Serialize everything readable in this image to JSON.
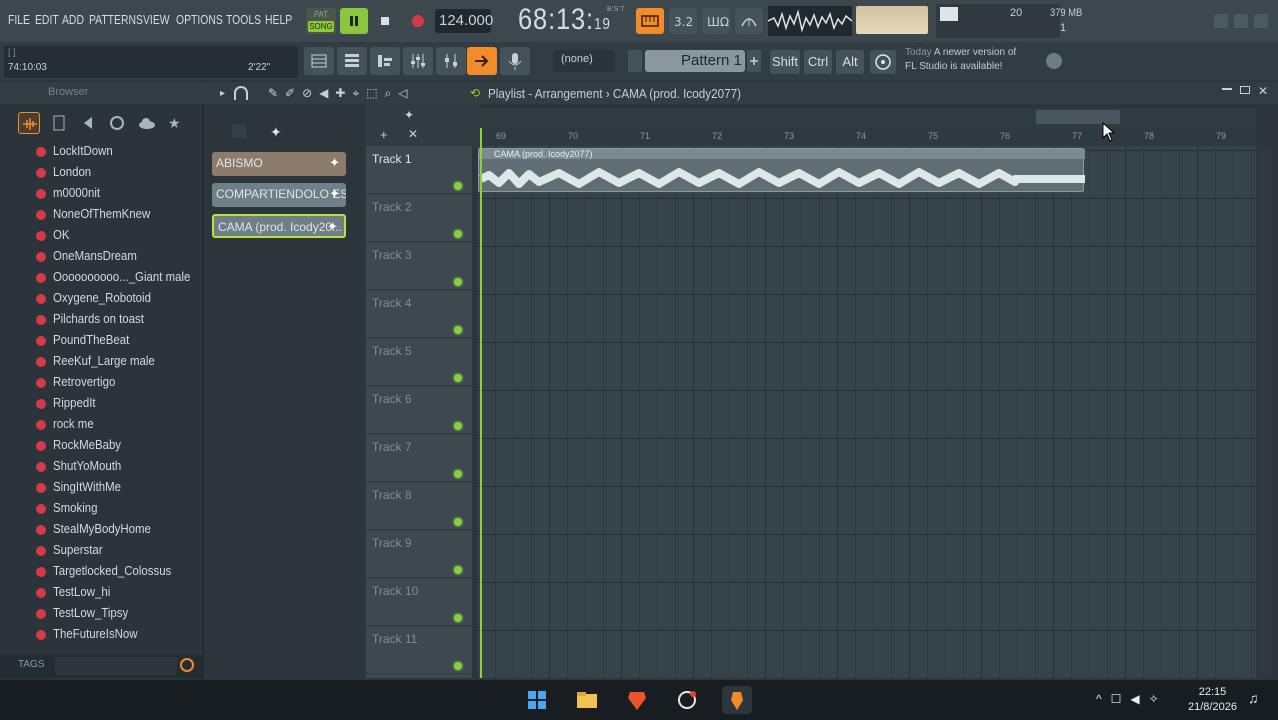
{
  "menu": {
    "file": "FILE",
    "edit": "EDIT",
    "add": "ADD",
    "patterns": "PATTERNS",
    "view": "VIEW",
    "options": "OPTIONS",
    "tools": "TOOLS",
    "help": "HELP"
  },
  "transport": {
    "mode_top": "PAT",
    "mode": "SONG",
    "tempo": "124.000",
    "time_main": "68:13:",
    "time_ms": "19",
    "time_unit": "B:S:T"
  },
  "monitor": {
    "cpu": "20",
    "memory": "379 MB",
    "polyphony": "1"
  },
  "hint": {
    "top": "[ ]",
    "time": "74:10:03",
    "length": "2'22\""
  },
  "pattern": {
    "none": "(none)",
    "name": "Pattern 1"
  },
  "modifiers": {
    "shift": "Shift",
    "ctrl": "Ctrl",
    "alt": "Alt"
  },
  "news": {
    "when": "Today",
    "line1": "A newer version of",
    "line2": "FL Studio is available!"
  },
  "browser": {
    "label": "Browser",
    "items": [
      "LockItDown",
      "London",
      "m0000nit",
      "NoneOfThemKnew",
      "OK",
      "OneMansDream",
      "Oooooooooo..._Giant male",
      "Oxygene_Robotoid",
      "Pilchards on toast",
      "PoundTheBeat",
      "ReeKuf_Large male",
      "Retrovertigo",
      "RippedIt",
      "rock me",
      "RockMeBaby",
      "ShutYoMouth",
      "SingItWithMe",
      "Smoking",
      "StealMyBodyHome",
      "Superstar",
      "Targetlocked_Colossus",
      "TestLow_hi",
      "TestLow_Tipsy",
      "TheFutureIsNow"
    ],
    "tags_label": "TAGS"
  },
  "clips": [
    "ABISMO",
    "COMPARTIENDOLO ES...",
    "CAMA (prod. Icody20..."
  ],
  "playlist": {
    "title": "Playlist - Arrangement",
    "separator": "›",
    "song": "CAMA (prod. Icody2077)",
    "clip_label": "CAMA (prod. Icody2077)"
  },
  "tracks": [
    "Track 1",
    "Track 2",
    "Track 3",
    "Track 4",
    "Track 5",
    "Track 6",
    "Track 7",
    "Track 8",
    "Track 9",
    "Track 10",
    "Track 11"
  ],
  "ruler": [
    "69",
    "70",
    "71",
    "72",
    "73",
    "74",
    "75",
    "76",
    "77",
    "78",
    "79"
  ],
  "clock": {
    "time": "22:15",
    "date": "21/8/2026"
  },
  "colors": {
    "accent": "#f28b2a",
    "play": "#8cc63f",
    "track_led": "#8dd03a",
    "record": "#d63a4a"
  }
}
